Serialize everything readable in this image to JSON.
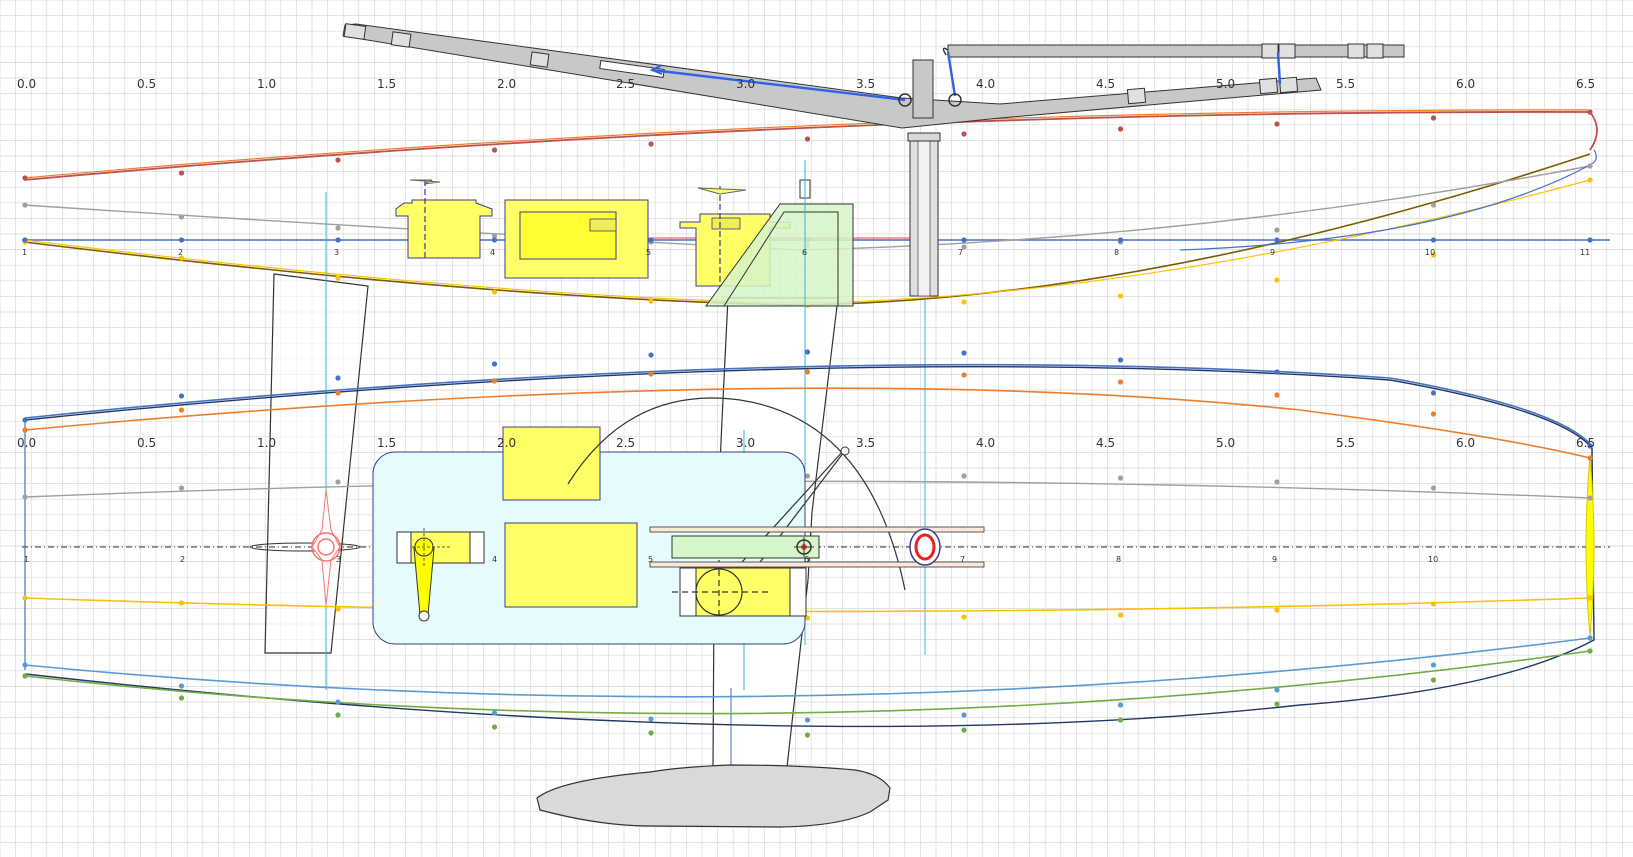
{
  "ruler_top": [
    "0.0",
    "0.5",
    "1.0",
    "1.5",
    "2.0",
    "2.5",
    "3.0",
    "3.5",
    "4.0",
    "4.5",
    "5.0",
    "5.5",
    "6.0",
    "6.5"
  ],
  "ruler_bottom": [
    "0.0",
    "0.5",
    "1.0",
    "1.5",
    "2.0",
    "2.5",
    "3.0",
    "3.5",
    "4.0",
    "4.5",
    "5.0",
    "5.5",
    "6.0",
    "6.5"
  ],
  "stations_top": [
    "1",
    "2",
    "3",
    "4",
    "5",
    "6",
    "7",
    "8",
    "9",
    "10",
    "11"
  ],
  "stations_bottom": [
    "1",
    "2",
    "3",
    "4",
    "5",
    "6",
    "7",
    "8",
    "9",
    "10"
  ],
  "colors": {
    "grid": "#d9d9d9",
    "sheer": "#c0504d",
    "orange": "#f07d2a",
    "gray": "#a0a0a0",
    "yellow": "#ffc000",
    "blue": "#4472c4",
    "lightblue": "#5b9bd5",
    "green": "#70ad47",
    "component": "#ffff66",
    "rig": "#c8c8c8",
    "control_line": "#2e62e8",
    "radio_tray": "#e6fbfb"
  },
  "components": {
    "hull_profile": "hull-side-view",
    "hull_plan": "hull-top-view",
    "keel_bulb": "keel-bulb",
    "fin": "keel-fin",
    "rudder": "rudder",
    "mast": "mast",
    "boom": "main-boom",
    "jib_boom": "jib-boom",
    "servos": [
      "rudder-servo",
      "sail-winch",
      "battery",
      "receiver"
    ],
    "sail_arm": "sail-arm",
    "mast_step": "mast-step"
  }
}
